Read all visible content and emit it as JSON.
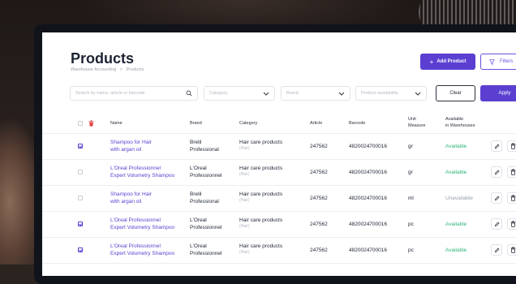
{
  "page": {
    "title": "Products",
    "breadcrumb": [
      "Warehouse Accounting",
      ">",
      "Products"
    ]
  },
  "toolbar": {
    "add_label": "Add Product",
    "add_icon": "+",
    "filters_label": "Filters",
    "filters_icon": "filter-icon"
  },
  "filters": {
    "search_placeholder": "Search by name, article or barcode",
    "category_placeholder": "Category",
    "brand_placeholder": "Brand",
    "availability_placeholder": "Product availability",
    "clear_label": "Clear",
    "apply_label": "Apply"
  },
  "table": {
    "headers": {
      "name": "Name",
      "brand": "Brand",
      "category": "Category",
      "article": "Article",
      "barcode": "Barcode",
      "unit_1": "Unit",
      "unit_2": "Measure",
      "available_1": "Available",
      "available_2": "in Warehouses"
    },
    "rows": [
      {
        "checked": true,
        "name_1": "Shampoo for Hair",
        "name_2": "with argan oil",
        "brand_1": "Brelil",
        "brand_2": "Professional",
        "category": "Hair care products",
        "category_sub": "(Hair)",
        "article": "247562",
        "barcode": "4820024700016",
        "unit": "gr",
        "availability": "Available"
      },
      {
        "checked": false,
        "name_1": "L'Oreal Professionnel",
        "name_2": "Expert Volumetry Shampoo",
        "brand_1": "L'Oreal",
        "brand_2": "Professionnel",
        "category": "Hair care products",
        "category_sub": "(Hair)",
        "article": "247562",
        "barcode": "4820024700016",
        "unit": "gr",
        "availability": "Available"
      },
      {
        "checked": false,
        "name_1": "Shampoo for Hair",
        "name_2": "with argan oil",
        "brand_1": "Brelil",
        "brand_2": "Professional",
        "category": "Hair care products",
        "category_sub": "(Hair)",
        "article": "247562",
        "barcode": "4820024700016",
        "unit": "ml",
        "availability": "Unavailable"
      },
      {
        "checked": true,
        "name_1": "L'Oreal Professionnel",
        "name_2": "Expert Volumetry Shampoo",
        "brand_1": "L'Oreal",
        "brand_2": "Professionnel",
        "category": "Hair care products",
        "category_sub": "(Hair)",
        "article": "247562",
        "barcode": "4820024700016",
        "unit": "pc",
        "availability": "Available"
      },
      {
        "checked": true,
        "name_1": "L'Oreal Professionnel",
        "name_2": "Expert Volumetry Shampoo",
        "brand_1": "L'Oreal",
        "brand_2": "Professionnel",
        "category": "Hair care products",
        "category_sub": "(Hair)",
        "article": "247562",
        "barcode": "4820024700016",
        "unit": "pc",
        "availability": "Available"
      }
    ]
  },
  "colors": {
    "accent": "#5b3fd1",
    "available": "#2fb57b",
    "unavailable": "#9aa1ad",
    "delete": "#e04848"
  }
}
